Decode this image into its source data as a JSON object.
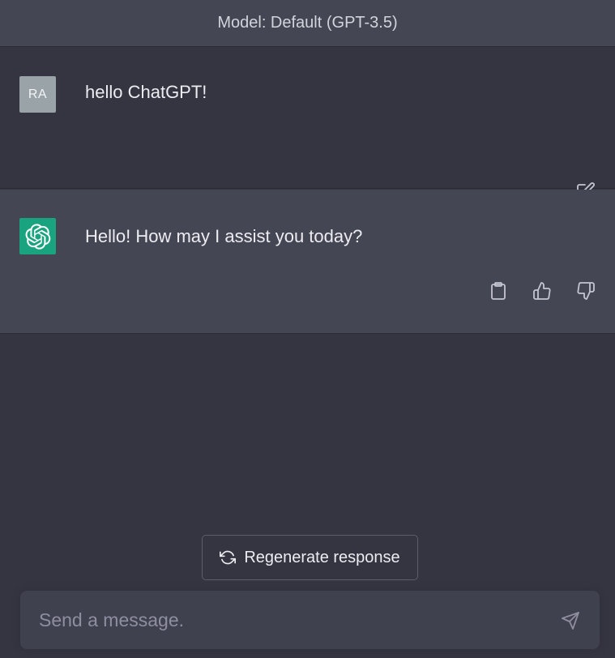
{
  "header": {
    "title": "Model: Default (GPT-3.5)"
  },
  "conversation": {
    "user_message": {
      "avatar_initials": "RA",
      "text": "hello ChatGPT!",
      "actions": [
        {
          "icon": "edit-icon"
        }
      ]
    },
    "assistant_message": {
      "avatar_icon": "openai-logo-icon",
      "text": "Hello! How may I assist you today?",
      "actions": [
        {
          "icon": "clipboard-icon"
        },
        {
          "icon": "thumbs-up-icon"
        },
        {
          "icon": "thumbs-down-icon"
        }
      ]
    }
  },
  "regenerate": {
    "icon": "refresh-icon",
    "label": "Regenerate response"
  },
  "composer": {
    "placeholder": "Send a message.",
    "value": "",
    "send_icon": "send-icon"
  },
  "colors": {
    "background": "#343541",
    "assistant_background": "#444654",
    "user_avatar": "#9aa3a8",
    "assistant_avatar": "#19a37f",
    "composer_background": "#40414f"
  }
}
